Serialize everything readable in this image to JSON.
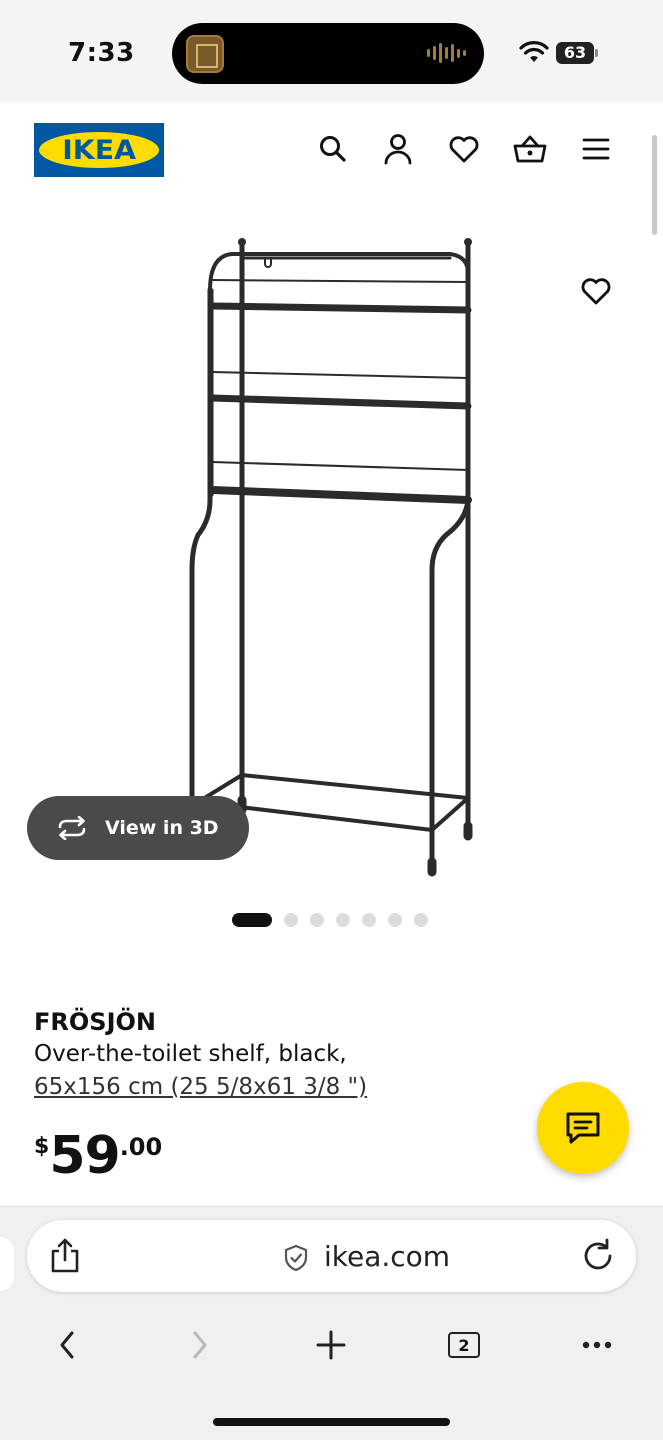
{
  "status_bar": {
    "time": "7:33",
    "battery": "63"
  },
  "header": {
    "logo_text": "IKEA",
    "icons": [
      "search-icon",
      "account-icon",
      "heart-icon",
      "basket-icon",
      "menu-icon"
    ]
  },
  "gallery": {
    "view_3d_label": "View in 3D",
    "image_count": 7,
    "active_index": 0
  },
  "product": {
    "name": "FRÖSJÖN",
    "description": "Over-the-toilet shelf, black,",
    "size": "65x156 cm (25 5/8x61 3/8 \")",
    "price": {
      "currency": "$",
      "integer": "59",
      "decimal": ".00"
    }
  },
  "browser": {
    "url": "ikea.com",
    "tab_count": "2"
  },
  "colors": {
    "brand_blue": "#0058a3",
    "brand_yellow": "#ffdb00",
    "dark_button": "#4a4a4a"
  }
}
